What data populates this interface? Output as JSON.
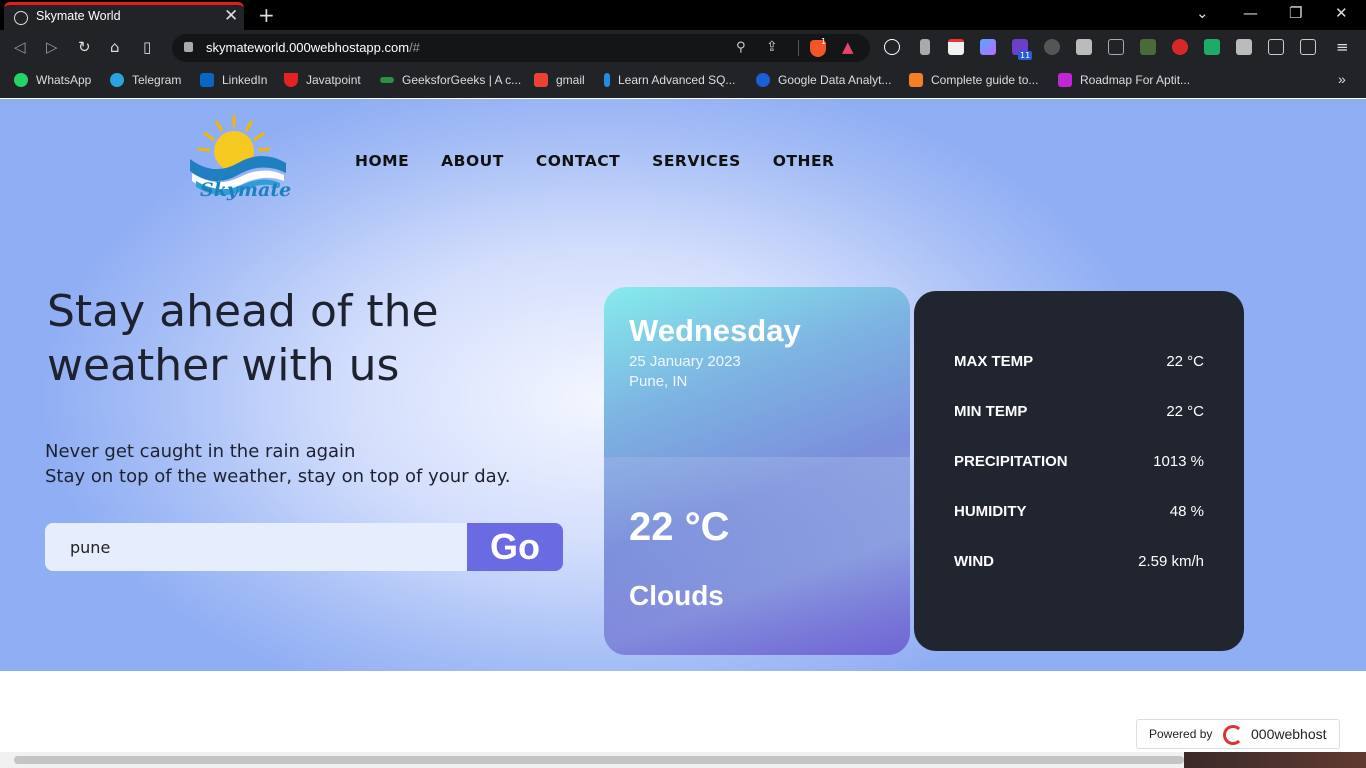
{
  "browser": {
    "tab_title": "Skymate World",
    "close_glyph": "✕",
    "newtab_glyph": "+",
    "url_host": "skymateworld.000webhostapp.com",
    "url_hash": "/#",
    "brave_badge": "1",
    "ext_badge": "11",
    "window": {
      "chevron": "⌄",
      "minimize": "—",
      "restore": "❐",
      "close": "✕"
    },
    "nav": {
      "back": "◁",
      "forward": "▷",
      "reload": "↻",
      "home": "⌂",
      "bookmark": "▯",
      "menu": "≡",
      "overflow": "»"
    },
    "bookmarks": [
      {
        "label": "WhatsApp",
        "color": "#25d366"
      },
      {
        "label": "Telegram",
        "color": "#2aa3df"
      },
      {
        "label": "LinkedIn",
        "color": "#0a66c2"
      },
      {
        "label": "Javatpoint",
        "color": "#e02424"
      },
      {
        "label": "GeeksforGeeks | A c...",
        "color": "#2f8d46"
      },
      {
        "label": "gmail",
        "color": "#ea4335"
      },
      {
        "label": "Learn Advanced SQ...",
        "color": "#2a8ae0"
      },
      {
        "label": "Google Data Analyt...",
        "color": "#1a5fd6"
      },
      {
        "label": "Complete guide to...",
        "color": "#f48024"
      },
      {
        "label": "Roadmap For Aptit...",
        "color": "#c026d3"
      }
    ]
  },
  "site": {
    "logo_text": "Skymate",
    "nav": [
      "HOME",
      "ABOUT",
      "CONTACT",
      "SERVICES",
      "OTHER"
    ],
    "headline": "Stay ahead of the weather with us",
    "sub1": "Never get caught in the rain again",
    "sub2": "Stay on top of the weather, stay on top of your day.",
    "search_value": "pune",
    "go_label": "Go",
    "card": {
      "day": "Wednesday",
      "date": "25 January 2023",
      "location": "Pune, IN",
      "temp": "22 °C",
      "condition": "Clouds"
    },
    "stats": [
      {
        "label": "MAX TEMP",
        "value": "22 °C"
      },
      {
        "label": "MIN TEMP",
        "value": "22 °C"
      },
      {
        "label": "PRECIPITATION",
        "value": "1013 %"
      },
      {
        "label": "HUMIDITY",
        "value": "48 %"
      },
      {
        "label": "WIND",
        "value": "2.59 km/h"
      }
    ],
    "powered_by": "Powered by",
    "host_name": "000webhost"
  },
  "colors": {
    "accent": "#6a6ae2",
    "stats_bg": "#212530",
    "tab_accent": "#e41e1e"
  }
}
